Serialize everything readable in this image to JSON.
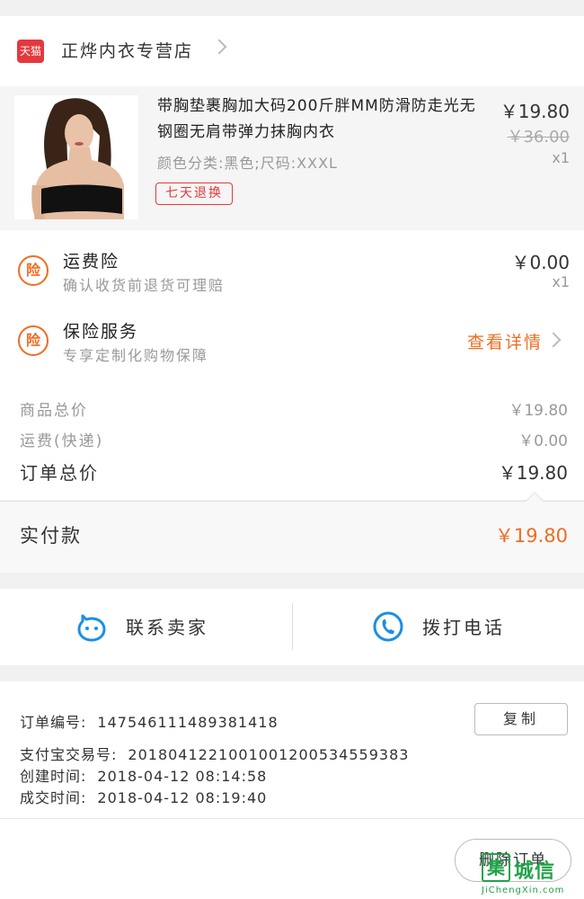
{
  "store": {
    "logo_text": "天猫",
    "name": "正烨内衣专营店"
  },
  "product": {
    "title": "带胸垫裹胸加大码200斤胖MM防滑防走光无钢圈无肩带弹力抹胸内衣",
    "attributes": "颜色分类:黑色;尺码:XXXL",
    "tag": "七天退换",
    "price": "￥19.80",
    "original_price": "￥36.00",
    "quantity": "x1"
  },
  "services": [
    {
      "icon_text": "险",
      "title": "运费险",
      "subtitle": "确认收货前退货可理赔",
      "price": "￥0.00",
      "quantity": "x1"
    },
    {
      "icon_text": "险",
      "title": "保险服务",
      "subtitle": "专享定制化购物保障",
      "link": "查看详情"
    }
  ],
  "summary": {
    "goods_total_label": "商品总价",
    "goods_total_value": "￥19.80",
    "shipping_label": "运费(快递)",
    "shipping_value": "￥0.00",
    "order_total_label": "订单总价",
    "order_total_value": "￥19.80"
  },
  "paid": {
    "label": "实付款",
    "value": "￥19.80"
  },
  "contact": {
    "seller_label": "联系卖家",
    "phone_label": "拨打电话"
  },
  "order_info": {
    "order_no_label": "订单编号:",
    "order_no": "147546111489381418",
    "alipay_label": "支付宝交易号:",
    "alipay_no": "2018041221001001200534559383",
    "created_label": "创建时间:",
    "created": "2018-04-12  08:14:58",
    "closed_label": "成交时间:",
    "closed": "2018-04-12  08:19:40",
    "copy_label": "复制"
  },
  "actions": {
    "delete_label": "删除订单"
  },
  "watermark": {
    "text": "城信",
    "box_text": "集",
    "sub": "JiChengXin.com"
  },
  "colors": {
    "accent_orange": "#f26c22",
    "tmall_red": "#e4393c",
    "icon_blue": "#1a8fe3",
    "watermark_green": "#22a34a"
  }
}
